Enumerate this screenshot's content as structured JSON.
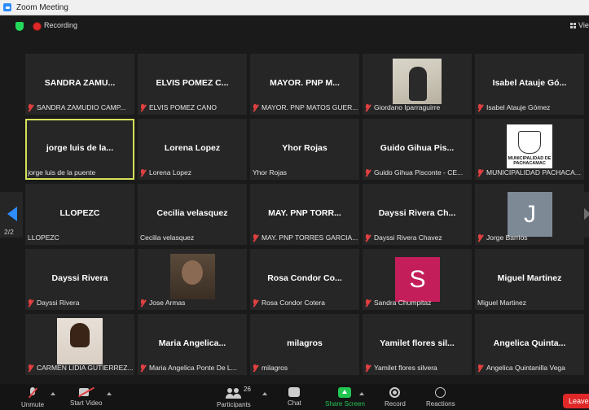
{
  "window": {
    "title": "Zoom Meeting"
  },
  "topbar": {
    "recording_label": "Recording",
    "view_label": "Vie"
  },
  "pagination": {
    "current": "2/2"
  },
  "colors": {
    "accent": "#2d8cff",
    "active_border": "#d5e05a",
    "mute": "#e04040",
    "share": "#23c552",
    "leave": "#e02828"
  },
  "tiles": [
    {
      "name": "SANDRA ZAMU...",
      "label": "SANDRA ZAMUDIO CAMP...",
      "muted": true
    },
    {
      "name": "ELVIS POMEZ C...",
      "label": "ELVIS POMEZ CANO",
      "muted": true
    },
    {
      "name": "MAYOR. PNP M...",
      "label": "MAYOR. PNP MATOS GUER...",
      "muted": true
    },
    {
      "name": "",
      "label": "Giordano Iparraguirre",
      "muted": true,
      "media": "photo-soldier"
    },
    {
      "name": "Isabel Atauje Gó...",
      "label": "Isabel Atauje Gómez",
      "muted": true
    },
    {
      "name": "jorge luis de la...",
      "label": "jorge luis de la puente",
      "muted": false,
      "active": true
    },
    {
      "name": "Lorena Lopez",
      "label": "Lorena Lopez",
      "muted": true
    },
    {
      "name": "Yhor Rojas",
      "label": "Yhor Rojas",
      "muted": false
    },
    {
      "name": "Guido Gihua Pis...",
      "label": "Guido Gihua Pisconte - CE...",
      "muted": true
    },
    {
      "name": "",
      "label": "MUNICIPALIDAD PACHACA...",
      "muted": true,
      "media": "logo",
      "logo_text": "MUNICIPALIDAD DE PACHACAMAC"
    },
    {
      "name": "LLOPEZC",
      "label": "LLOPEZC",
      "muted": false
    },
    {
      "name": "Cecilia velasquez",
      "label": "Cecilia velasquez",
      "muted": false
    },
    {
      "name": "MAY. PNP TORR...",
      "label": "MAY. PNP TORRES GARCIA...",
      "muted": true
    },
    {
      "name": "Dayssi Rivera Ch...",
      "label": "Dayssi Rivera Chavez",
      "muted": true
    },
    {
      "name": "",
      "label": "Jorge Barrios",
      "muted": true,
      "media": "avatar",
      "avatar_letter": "J",
      "avatar_color": "#7d8a96"
    },
    {
      "name": "Dayssi Rivera",
      "label": "Dayssi Rivera",
      "muted": true
    },
    {
      "name": "",
      "label": "Jose Armas",
      "muted": true,
      "media": "photo-man"
    },
    {
      "name": "Rosa Condor Co...",
      "label": "Rosa Condor Cotera",
      "muted": true
    },
    {
      "name": "",
      "label": "Sandra Chumpitaz",
      "muted": true,
      "media": "avatar",
      "avatar_letter": "S",
      "avatar_color": "#c41e5a"
    },
    {
      "name": "Miguel Martinez",
      "label": "Miguel Martinez",
      "muted": false
    },
    {
      "name": "",
      "label": "CARMEN LIDIA GUTIERREZ...",
      "muted": true,
      "media": "photo-woman"
    },
    {
      "name": "Maria Angelica...",
      "label": "Maria Angelica Ponte De L...",
      "muted": true
    },
    {
      "name": "milagros",
      "label": "milagros",
      "muted": true
    },
    {
      "name": "Yamilet flores sil...",
      "label": "Yamilet flores silvera",
      "muted": true
    },
    {
      "name": "Angelica Quinta...",
      "label": "Angelica Quintanilla Vega",
      "muted": true
    }
  ],
  "toolbar": {
    "unmute": "Unmute",
    "start_video": "Start Video",
    "participants": "Participants",
    "participants_count": "26",
    "chat": "Chat",
    "share_screen": "Share Screen",
    "record": "Record",
    "reactions": "Reactions",
    "leave": "Leave"
  }
}
